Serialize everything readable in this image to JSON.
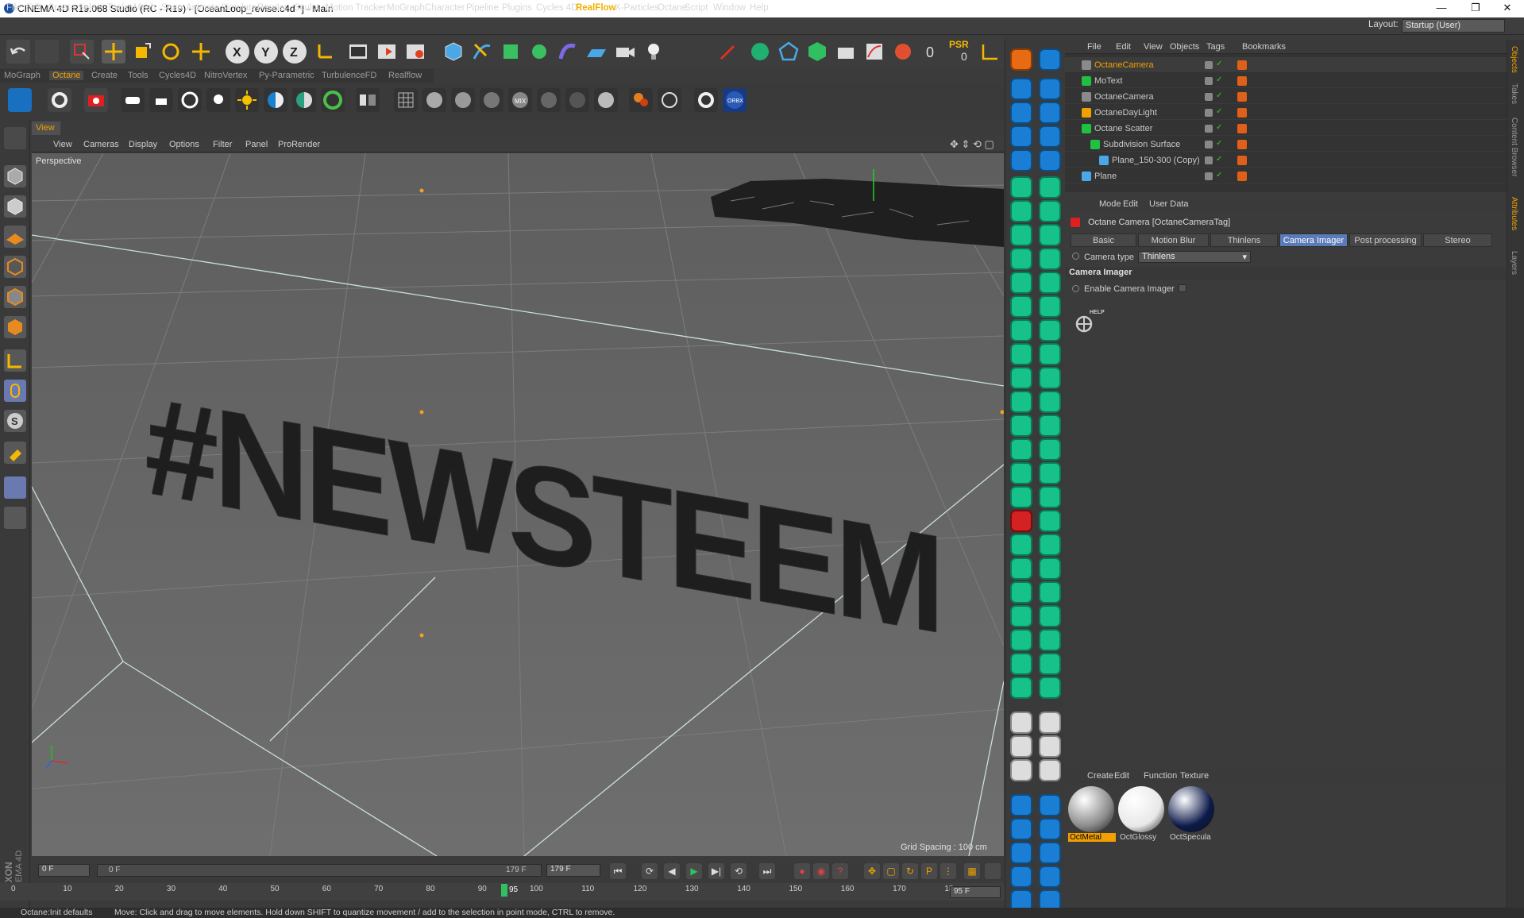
{
  "window": {
    "title": "CINEMA 4D R19.068 Studio (RC - R19) - [OceanLoop_revise.c4d *] - Main",
    "minimize": "—",
    "maximize": "❐",
    "close": "✕"
  },
  "menubar": [
    "File",
    "Edit",
    "Create",
    "Select",
    "Tools",
    "Mesh",
    "Snap",
    "Animate",
    "Simulate",
    "Render",
    "Sculpt",
    "Motion Tracker",
    "MoGraph",
    "Character",
    "Pipeline",
    "Plugins",
    "Cycles 4D",
    "RealFlow",
    "X-Particles",
    "Octane",
    "Script",
    "Window",
    "Help"
  ],
  "layout": {
    "label": "Layout:",
    "value": "Startup (User)"
  },
  "toolbar1": {
    "psr_label": "PSR",
    "psr_value": "0"
  },
  "plugin_tabs": [
    "MoGraph",
    "Octane",
    "Create",
    "Tools",
    "Cycles4D",
    "NitroVertex",
    "Py-Parametric",
    "TurbulenceFD",
    "Realflow"
  ],
  "active_plugin_tab": "Octane",
  "view_tab": "View",
  "viewport_menu": [
    "View",
    "Cameras",
    "Display",
    "Options",
    "Filter",
    "Panel",
    "ProRender"
  ],
  "viewport": {
    "label": "Perspective",
    "grid_spacing": "Grid Spacing : 100 cm",
    "text_object": "#NEWSTEEM"
  },
  "object_manager": {
    "menu": [
      "File",
      "Edit",
      "View",
      "Objects",
      "Tags",
      "Bookmarks"
    ],
    "objects": [
      {
        "name": "OctaneCamera",
        "selected": true,
        "indent": 0
      },
      {
        "name": "MoText",
        "selected": false,
        "indent": 0
      },
      {
        "name": "OctaneCamera",
        "selected": false,
        "indent": 0
      },
      {
        "name": "OctaneDayLight",
        "selected": false,
        "indent": 0
      },
      {
        "name": "Octane Scatter",
        "selected": false,
        "indent": 0
      },
      {
        "name": "Subdivision Surface",
        "selected": false,
        "indent": 1
      },
      {
        "name": "Plane_150-300 (Copy)",
        "selected": false,
        "indent": 2
      },
      {
        "name": "Plane",
        "selected": false,
        "indent": 0
      }
    ]
  },
  "attributes": {
    "menu": [
      "Mode",
      "Edit",
      "User Data"
    ],
    "title": "Octane Camera [OctaneCameraTag]",
    "tabs": [
      "Basic",
      "Motion Blur",
      "Thinlens",
      "Camera Imager",
      "Post processing",
      "Stereo"
    ],
    "active_tab": "Camera Imager",
    "camera_type_label": "Camera type",
    "camera_type_value": "Thinlens",
    "section": "Camera Imager",
    "enable_label": "Enable Camera Imager",
    "help_label": "HELP"
  },
  "right_strip": [
    "Objects",
    "Takes",
    "Content Browser",
    "Attributes",
    "Layers"
  ],
  "material_manager": {
    "menu": [
      "Create",
      "Edit",
      "Function",
      "Texture"
    ],
    "materials": [
      {
        "name": "OctMetal",
        "selected": true,
        "color": "#8a8a8a"
      },
      {
        "name": "OctGlossy",
        "selected": false,
        "color": "#e8e8e8"
      },
      {
        "name": "OctSpecula",
        "selected": false,
        "color": "#0c1a4a"
      }
    ]
  },
  "timeline": {
    "current_frame": "0 F",
    "range_start": "0 F",
    "range_end": "179 F",
    "end_frame": "179 F",
    "playhead": "95",
    "frame_field": "95 F",
    "ticks": [
      "0",
      "10",
      "20",
      "30",
      "40",
      "50",
      "60",
      "70",
      "80",
      "90",
      "100",
      "110",
      "120",
      "130",
      "140",
      "150",
      "160",
      "170",
      "18"
    ]
  },
  "status": {
    "left": "Octane:Init defaults",
    "message": "Move: Click and drag to move elements. Hold down SHIFT to quantize movement / add to the selection in point mode, CTRL to remove."
  },
  "branding": {
    "maxon": "MAXON",
    "c4d": "CINEMA 4D"
  },
  "colors": {
    "accent": "#f0a000",
    "octane_green": "#16c28a",
    "selected_tab": "#5a7ab8"
  }
}
